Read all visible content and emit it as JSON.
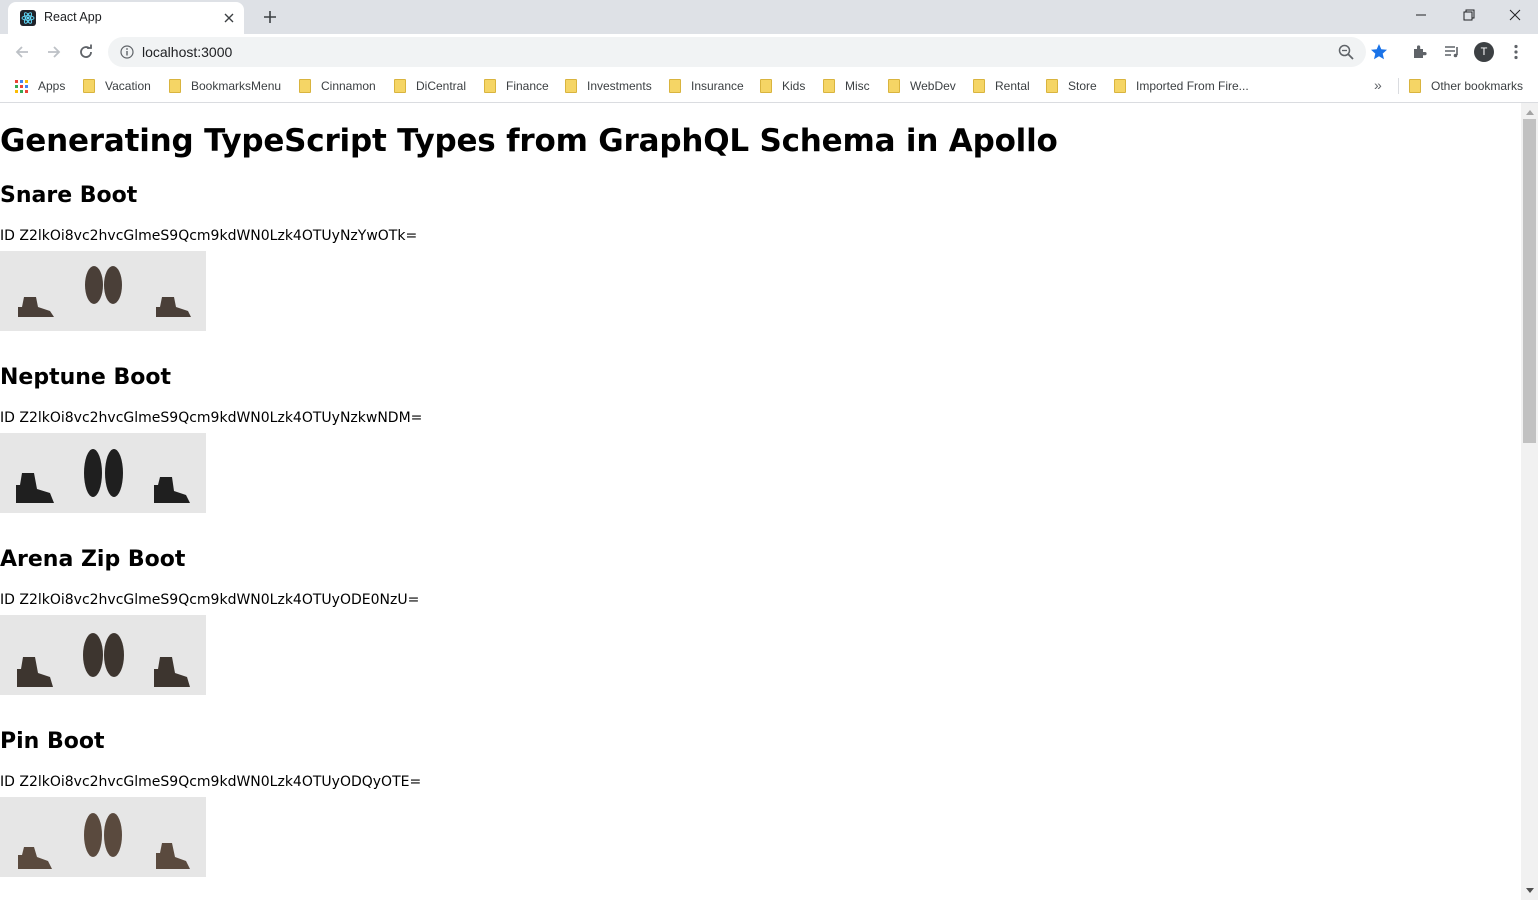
{
  "browser": {
    "tab_title": "React App",
    "url": "localhost:3000",
    "profile_initial": "T",
    "accent_color": "#1a73e8",
    "icons": {
      "favicon": "react-logo-icon",
      "tab_close": "close-icon",
      "new_tab": "plus-icon",
      "minimize": "minimize-icon",
      "restore": "restore-icon",
      "close_window": "close-icon",
      "back": "back-arrow-icon",
      "forward": "forward-arrow-icon",
      "reload": "reload-icon",
      "site_info": "info-icon",
      "zoom": "zoom-icon",
      "bookmark_star": "star-icon",
      "extensions": "puzzle-icon",
      "media": "media-queue-icon",
      "menu": "kebab-menu-icon"
    }
  },
  "bookmarks": {
    "apps_label": "Apps",
    "items": [
      "Vacation",
      "BookmarksMenu",
      "Cinnamon",
      "DiCentral",
      "Finance",
      "Investments",
      "Insurance",
      "Kids",
      "Misc",
      "WebDev",
      "Rental",
      "Store",
      "Imported From Fire..."
    ],
    "overflow_label": "»",
    "other_label": "Other bookmarks"
  },
  "page": {
    "title": "Generating TypeScript Types from GraphQL Schema in Apollo",
    "products": [
      {
        "name": "Snare Boot",
        "id_text": "ID Z2lkOi8vc2hvcGlmeS9Qcm9kdWN0Lzk4OTUyNzYwOTk=",
        "boot_color": "#4a3f38"
      },
      {
        "name": "Neptune Boot",
        "id_text": "ID Z2lkOi8vc2hvcGlmeS9Qcm9kdWN0Lzk4OTUyNzkwNDM=",
        "boot_color": "#1f1f1f"
      },
      {
        "name": "Arena Zip Boot",
        "id_text": "ID Z2lkOi8vc2hvcGlmeS9Qcm9kdWN0Lzk4OTUyODE0NzU=",
        "boot_color": "#3d352f"
      },
      {
        "name": "Pin Boot",
        "id_text": "ID Z2lkOi8vc2hvcGlmeS9Qcm9kdWN0Lzk4OTUyODQyOTE=",
        "boot_color": "#5a4a3e"
      }
    ]
  }
}
